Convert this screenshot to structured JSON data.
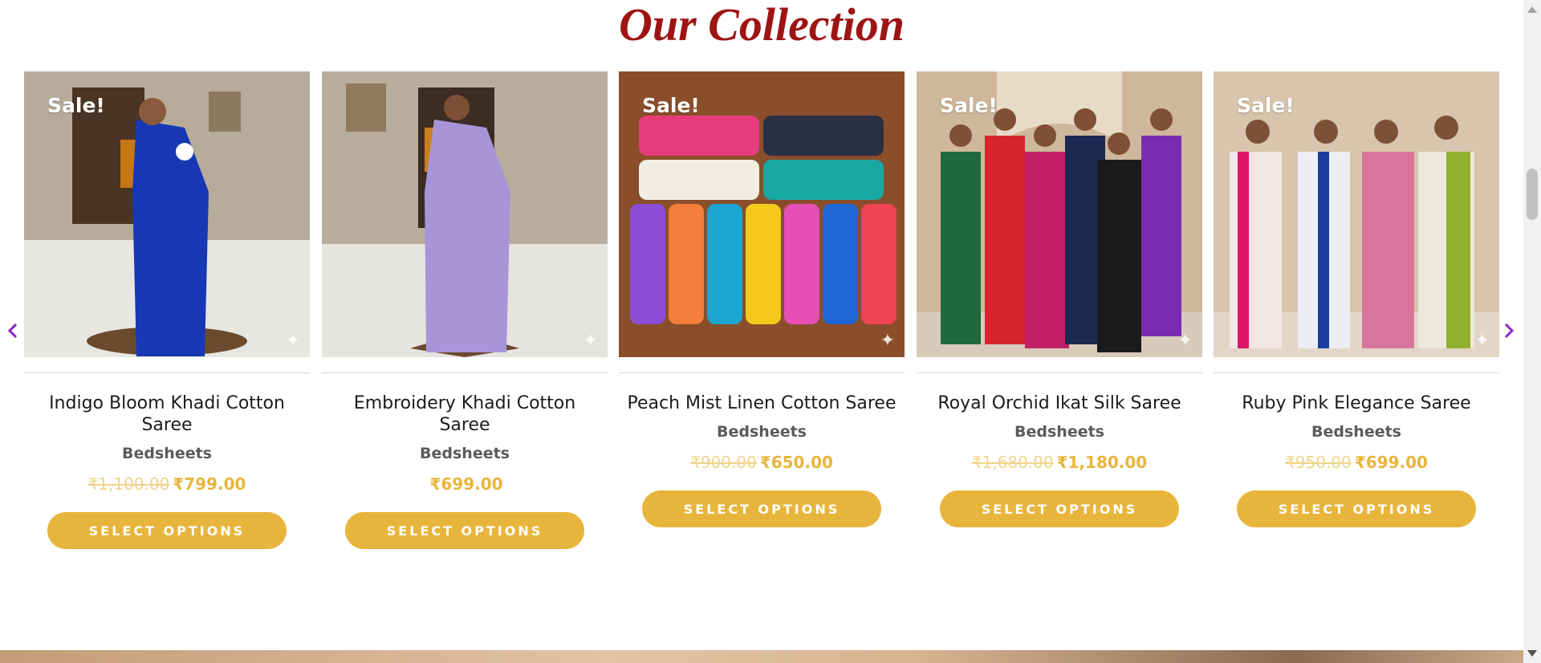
{
  "section": {
    "title": "Our Collection"
  },
  "carousel": {
    "prev_icon": "chevron-left-icon",
    "next_icon": "chevron-right-icon",
    "arrow_color": "#8b24c9"
  },
  "theme": {
    "accent": "#e8b53c",
    "title_color": "#9e1414"
  },
  "products": [
    {
      "sale_badge": "Sale!",
      "name": "Indigo Bloom Khadi Cotton Saree",
      "category": "Bedsheets",
      "old_price": "₹1,100.00",
      "price": "₹799.00",
      "button": "SELECT OPTIONS"
    },
    {
      "sale_badge": "",
      "name": "Embroidery Khadi Cotton Saree",
      "category": "Bedsheets",
      "old_price": "",
      "price": "₹699.00",
      "button": "SELECT OPTIONS"
    },
    {
      "sale_badge": "Sale!",
      "name": "Peach Mist Linen Cotton Saree",
      "category": "Bedsheets",
      "old_price": "₹900.00",
      "price": "₹650.00",
      "button": "SELECT OPTIONS"
    },
    {
      "sale_badge": "Sale!",
      "name": "Royal Orchid Ikat Silk Saree",
      "category": "Bedsheets",
      "old_price": "₹1,680.00",
      "price": "₹1,180.00",
      "button": "SELECT OPTIONS"
    },
    {
      "sale_badge": "Sale!",
      "name": "Ruby Pink Elegance Saree",
      "category": "Bedsheets",
      "old_price": "₹950.00",
      "price": "₹699.00",
      "button": "SELECT OPTIONS"
    }
  ]
}
